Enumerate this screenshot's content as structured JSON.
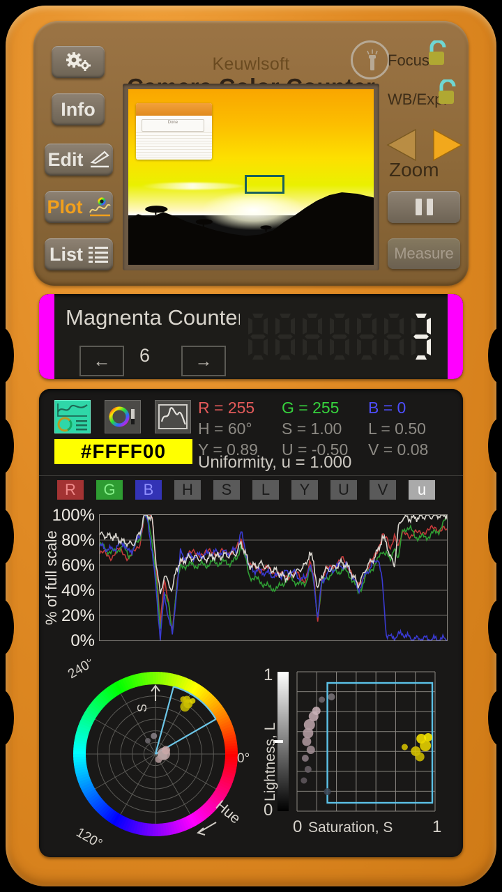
{
  "device": {
    "body_color": "#e08a24",
    "panel_color": "#8d6939"
  },
  "header": {
    "brand": "Keuwlsoft",
    "title": "Camera Color Counter",
    "torch_icon": "flashlight-icon"
  },
  "left_buttons": [
    {
      "label": "",
      "icon": "gears-icon",
      "name": "settings"
    },
    {
      "label": "Info",
      "icon": "",
      "name": "info"
    },
    {
      "label": "Edit",
      "icon": "pencil-icon",
      "name": "edit"
    },
    {
      "label": "Plot",
      "icon": "plot-icon",
      "name": "plot"
    },
    {
      "label": "List",
      "icon": "list-icon",
      "name": "list"
    }
  ],
  "right_controls": {
    "focus_label": "Focus",
    "focus_lock": "unlocked-padlock-icon",
    "wb_label": "WB/Exp.",
    "wb_lock": "unlocked-padlock-icon",
    "zoom_label": "Zoom",
    "zoom_out_icon": "triangle-left-icon",
    "zoom_in_icon": "triangle-right-icon",
    "pause_icon": "pause-icon",
    "measure_label": "Measure"
  },
  "preview": {
    "scene": "sunset-landscape",
    "roi_color": "#19605a",
    "popup_button_label": "Done"
  },
  "counter": {
    "title": "Magnenta Counter",
    "index": "6",
    "prev_icon": "arrow-left-icon",
    "next_icon": "arrow-right-icon",
    "digits": [
      "",
      "",
      "",
      "",
      "",
      "",
      "3"
    ],
    "digit_count": 7,
    "accent_color": "#ff00ff"
  },
  "readout": {
    "modes": [
      {
        "name": "combined-view",
        "selected": true
      },
      {
        "name": "color-wheel-view",
        "selected": false
      },
      {
        "name": "trace-view",
        "selected": false
      }
    ],
    "hex": "#FFFF00",
    "values": [
      {
        "label": "R = 255",
        "color": "#e35a5a"
      },
      {
        "label": "G = 255",
        "color": "#36d23d"
      },
      {
        "label": "B = 0",
        "color": "#4e4eff"
      },
      {
        "label": "H = 60°",
        "color": "#8d8a84"
      },
      {
        "label": "S = 1.00",
        "color": "#8d8a84"
      },
      {
        "label": "L = 0.50",
        "color": "#8d8a84"
      },
      {
        "label": "Y = 0.89",
        "color": "#8d8a84"
      },
      {
        "label": "U = -0.50",
        "color": "#8d8a84"
      },
      {
        "label": "V = 0.08",
        "color": "#8d8a84"
      }
    ],
    "uniformity": "Uniformity, u = 1.000"
  },
  "channel_chips": [
    {
      "label": "R",
      "bg": "#a33333",
      "fg": "#f08b8b",
      "active": true
    },
    {
      "label": "G",
      "bg": "#2e9c32",
      "fg": "#86f08a",
      "active": true
    },
    {
      "label": "B",
      "bg": "#3333b5",
      "fg": "#8f8fff",
      "active": true
    },
    {
      "label": "H",
      "bg": "#5a5a5a",
      "fg": "#1b1b1b",
      "active": false
    },
    {
      "label": "S",
      "bg": "#5a5a5a",
      "fg": "#1b1b1b",
      "active": false
    },
    {
      "label": "L",
      "bg": "#5a5a5a",
      "fg": "#1b1b1b",
      "active": false
    },
    {
      "label": "Y",
      "bg": "#5a5a5a",
      "fg": "#1b1b1b",
      "active": false
    },
    {
      "label": "U",
      "bg": "#5a5a5a",
      "fg": "#1b1b1b",
      "active": false
    },
    {
      "label": "V",
      "bg": "#5a5a5a",
      "fg": "#1b1b1b",
      "active": false
    },
    {
      "label": "u",
      "bg": "#aaaaaa",
      "fg": "#ffffff",
      "active": true
    }
  ],
  "chart_data": [
    {
      "type": "line",
      "title": "",
      "xlabel": "",
      "ylabel": "% of full scale",
      "ylim": [
        0,
        100
      ],
      "yticks": [
        "0%",
        "20%",
        "40%",
        "60%",
        "80%",
        "100%"
      ],
      "grid": true,
      "legend": "none",
      "series": [
        {
          "name": "R",
          "color": "#c33a3a",
          "values": [
            69,
            69,
            68,
            67,
            70,
            72,
            70,
            66,
            68,
            72,
            78,
            100,
            100,
            98,
            60,
            12,
            46,
            33,
            8,
            40,
            62,
            66,
            70,
            69,
            69,
            70,
            69,
            70,
            71,
            70,
            70,
            70,
            71,
            72,
            73,
            80,
            72,
            60,
            58,
            58,
            57,
            57,
            56,
            55,
            54,
            52,
            50,
            52,
            53,
            52,
            48,
            50,
            62,
            50,
            16,
            48,
            55,
            58,
            60,
            62,
            64,
            62,
            58,
            50,
            42,
            48,
            56,
            60,
            66,
            74,
            85,
            80,
            72,
            86,
            75,
            84,
            86,
            84,
            85,
            85,
            87,
            88,
            88,
            89,
            89,
            90,
            86
          ]
        },
        {
          "name": "G",
          "color": "#2f9e34",
          "values": [
            76,
            74,
            72,
            70,
            71,
            74,
            75,
            68,
            70,
            76,
            82,
            100,
            96,
            80,
            48,
            8,
            40,
            28,
            6,
            42,
            58,
            60,
            60,
            60,
            60,
            60,
            60,
            61,
            62,
            62,
            62,
            62,
            62,
            63,
            64,
            78,
            66,
            52,
            50,
            48,
            47,
            44,
            42,
            42,
            41,
            44,
            48,
            50,
            48,
            46,
            44,
            46,
            58,
            46,
            20,
            44,
            50,
            52,
            54,
            55,
            56,
            55,
            52,
            46,
            38,
            44,
            52,
            56,
            60,
            64,
            72,
            70,
            62,
            76,
            64,
            88,
            90,
            88,
            84,
            82,
            82,
            83,
            84,
            86,
            88,
            92,
            98
          ]
        },
        {
          "name": "B",
          "color": "#3a3ad0",
          "values": [
            75,
            74,
            73,
            72,
            74,
            77,
            78,
            70,
            72,
            78,
            84,
            100,
            94,
            70,
            40,
            2,
            36,
            20,
            4,
            38,
            70,
            66,
            68,
            67,
            67,
            68,
            68,
            69,
            70,
            70,
            70,
            70,
            70,
            71,
            72,
            86,
            74,
            58,
            56,
            56,
            55,
            54,
            53,
            52,
            51,
            52,
            54,
            55,
            54,
            52,
            48,
            50,
            60,
            48,
            18,
            46,
            52,
            55,
            57,
            59,
            60,
            59,
            56,
            48,
            40,
            46,
            54,
            58,
            62,
            66,
            46,
            5,
            2,
            3,
            4,
            6,
            3,
            2,
            1,
            1,
            2,
            1,
            1,
            1,
            1,
            1,
            1
          ]
        },
        {
          "name": "u",
          "color": "#d8d5ce",
          "values": [
            84,
            84,
            83,
            83,
            82,
            80,
            78,
            78,
            76,
            80,
            86,
            100,
            100,
            96,
            62,
            36,
            52,
            46,
            40,
            58,
            62,
            64,
            66,
            66,
            66,
            65,
            65,
            66,
            67,
            67,
            67,
            68,
            68,
            69,
            70,
            78,
            70,
            60,
            59,
            60,
            61,
            59,
            57,
            56,
            55,
            52,
            50,
            52,
            53,
            55,
            58,
            60,
            70,
            62,
            40,
            52,
            56,
            57,
            58,
            60,
            62,
            60,
            56,
            50,
            44,
            50,
            58,
            62,
            66,
            72,
            82,
            78,
            66,
            60,
            90,
            98,
            98,
            97,
            98,
            98,
            99,
            99,
            99,
            99,
            100,
            100,
            100
          ]
        }
      ]
    },
    {
      "type": "scatter",
      "title": "",
      "xlabel": "Hue",
      "ylabel": "S",
      "polar": true,
      "angle_ticks": [
        "0°",
        "120°",
        "240°"
      ],
      "selection_wedge": {
        "start_deg": 30,
        "end_deg": 75
      },
      "points": [
        {
          "angle": 60,
          "r": 0.9,
          "color": "#cfc200",
          "size": 11
        },
        {
          "angle": 57,
          "r": 0.86,
          "color": "#d6c800",
          "size": 13
        },
        {
          "angle": 63,
          "r": 0.88,
          "color": "#cfc000",
          "size": 9
        },
        {
          "angle": 58,
          "r": 0.8,
          "color": "#c9bd00",
          "size": 14
        },
        {
          "angle": 55,
          "r": 0.93,
          "color": "#e0d400",
          "size": 8
        },
        {
          "angle": 2,
          "r": 0.12,
          "color": "#c4a9a9",
          "size": 18
        },
        {
          "angle": 350,
          "r": 0.1,
          "color": "#b8a3a3",
          "size": 14
        },
        {
          "angle": 20,
          "r": 0.16,
          "color": "#caa8a8",
          "size": 12
        },
        {
          "angle": 95,
          "r": 0.26,
          "color": "#8a8288",
          "size": 9
        },
        {
          "angle": 120,
          "r": 0.22,
          "color": "#6e6a6e",
          "size": 8
        },
        {
          "angle": 300,
          "r": 0.09,
          "color": "#b49a9a",
          "size": 10
        }
      ]
    },
    {
      "type": "scatter",
      "title": "",
      "xlabel": "Saturation, S",
      "ylabel": "Lightness, L",
      "xlim": [
        0,
        1
      ],
      "ylim": [
        0,
        1
      ],
      "xticks": [
        "0",
        "1"
      ],
      "yticks": [
        "0",
        "1"
      ],
      "grid": true,
      "selection_box": {
        "x0": 0.22,
        "y0": 0.06,
        "x1": 0.98,
        "y1": 0.92
      },
      "marker_L": 0.5,
      "points": [
        {
          "x": 0.9,
          "y": 0.52,
          "color": "#f5e000",
          "size": 14
        },
        {
          "x": 0.95,
          "y": 0.53,
          "color": "#f8e800",
          "size": 12
        },
        {
          "x": 0.93,
          "y": 0.47,
          "color": "#e8d400",
          "size": 16
        },
        {
          "x": 0.86,
          "y": 0.43,
          "color": "#d8c400",
          "size": 14
        },
        {
          "x": 0.89,
          "y": 0.39,
          "color": "#cbb800",
          "size": 13
        },
        {
          "x": 0.78,
          "y": 0.46,
          "color": "#d4c000",
          "size": 9
        },
        {
          "x": 0.12,
          "y": 0.68,
          "color": "#c2aab0",
          "size": 14
        },
        {
          "x": 0.09,
          "y": 0.62,
          "color": "#bba3aa",
          "size": 16
        },
        {
          "x": 0.08,
          "y": 0.56,
          "color": "#b49da4",
          "size": 15
        },
        {
          "x": 0.07,
          "y": 0.5,
          "color": "#ad969d",
          "size": 13
        },
        {
          "x": 0.1,
          "y": 0.44,
          "color": "#a08d94",
          "size": 12
        },
        {
          "x": 0.06,
          "y": 0.38,
          "color": "#8a7b83",
          "size": 10
        },
        {
          "x": 0.14,
          "y": 0.72,
          "color": "#c9b2b8",
          "size": 12
        },
        {
          "x": 0.18,
          "y": 0.8,
          "color": "#6d676d",
          "size": 9
        },
        {
          "x": 0.25,
          "y": 0.82,
          "color": "#787278",
          "size": 10
        },
        {
          "x": 0.08,
          "y": 0.3,
          "color": "#6a6168",
          "size": 10
        },
        {
          "x": 0.05,
          "y": 0.22,
          "color": "#5e565d",
          "size": 9
        },
        {
          "x": 0.22,
          "y": 0.14,
          "color": "#3d4654",
          "size": 10
        }
      ]
    }
  ]
}
